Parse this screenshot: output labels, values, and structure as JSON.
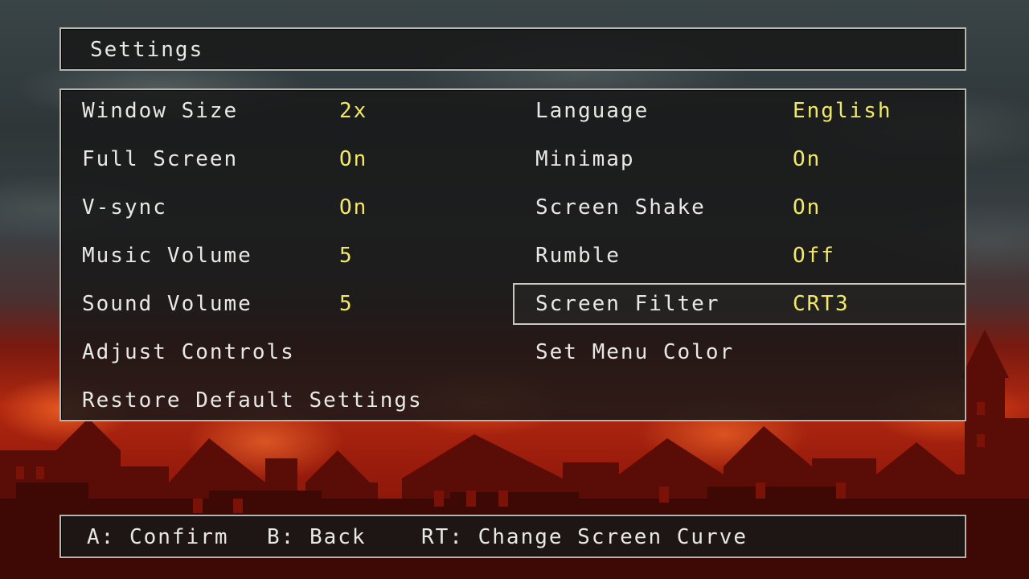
{
  "title": "Settings",
  "left_column": [
    {
      "label": "Window Size",
      "value": "2x"
    },
    {
      "label": "Full Screen",
      "value": "On"
    },
    {
      "label": "V-sync",
      "value": "On"
    },
    {
      "label": "Music Volume",
      "value": "5"
    },
    {
      "label": "Sound Volume",
      "value": "5"
    },
    {
      "label": "Adjust Controls",
      "value": ""
    },
    {
      "label": "Restore Default Settings",
      "value": ""
    }
  ],
  "right_column": [
    {
      "label": "Language",
      "value": "English"
    },
    {
      "label": "Minimap",
      "value": "On"
    },
    {
      "label": "Screen Shake",
      "value": "On"
    },
    {
      "label": "Rumble",
      "value": "Off"
    },
    {
      "label": "Screen Filter",
      "value": "CRT3"
    },
    {
      "label": "Set Menu Color",
      "value": ""
    }
  ],
  "selected_option": "Screen Filter",
  "footer": {
    "confirm": "A: Confirm",
    "back": "B: Back",
    "curve": "RT: Change Screen Curve"
  },
  "colors": {
    "label": "#e8e8e4",
    "value": "#f2e86a",
    "panel_border": "#b6b6ae"
  }
}
